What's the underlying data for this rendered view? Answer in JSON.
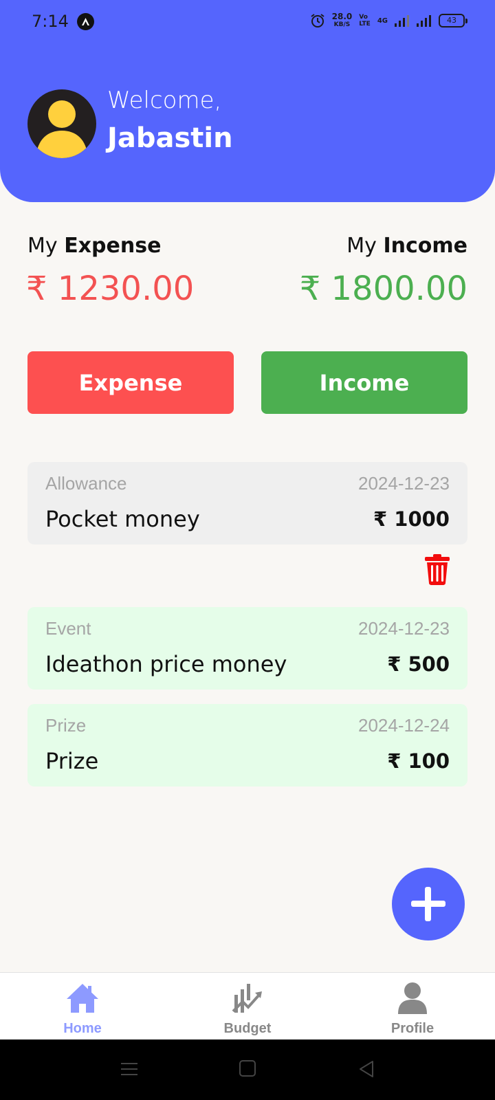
{
  "status_bar": {
    "time": "7:14",
    "speed_value": "28.0",
    "speed_unit": "KB/S",
    "volte_top": "Vo",
    "volte_bottom": "LTE",
    "network": "4G",
    "battery": "43"
  },
  "header": {
    "welcome": "Welcome,",
    "username": "Jabastin",
    "color": "#5565fd"
  },
  "summary": {
    "expense_prefix": "My",
    "expense_label": "Expense",
    "expense_value": "₹ 1230.00",
    "income_prefix": "My",
    "income_label": "Income",
    "income_value": "₹ 1800.00",
    "expense_color": "#f35252",
    "income_color": "#4caf50"
  },
  "actions": {
    "expense_button": "Expense",
    "income_button": "Income"
  },
  "transactions": [
    {
      "category": "Allowance",
      "date": "2024-12-23",
      "title": "Pocket money",
      "amount": "₹ 1000"
    },
    {
      "category": "Event",
      "date": "2024-12-23",
      "title": "Ideathon price money",
      "amount": "₹ 500"
    },
    {
      "category": "Prize",
      "date": "2024-12-24",
      "title": "Prize",
      "amount": "₹ 100"
    }
  ],
  "icons": {
    "delete": "trash-icon",
    "fab": "plus-icon",
    "home": "home-icon",
    "budget": "chart-icon",
    "profile": "person-icon"
  },
  "bottom_nav": {
    "home": "Home",
    "budget": "Budget",
    "profile": "Profile",
    "active": "Home"
  }
}
